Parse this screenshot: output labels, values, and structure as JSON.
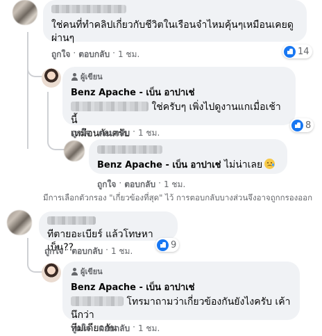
{
  "comments": [
    {
      "text": "ใช่คนที่ทำคลิปเกี่ยวกับชีวิตในเรือนจำไหมคุ้นๆเหมือนเคยดูผ่านๆ",
      "line1": "ใช่คนที่ทำคลิปเกี่ยวกับชีวิตในเรือนจำไหมคุ้นๆเหมือนเคยดู",
      "line2": "ผ่านๆ",
      "like": "ถูกใจ",
      "reply": "ตอบกลับ",
      "time": "1 ชม.",
      "reactions": "14",
      "replies": [
        {
          "author_badge": "ผู้เขียน",
          "author": "Benz Apache - เบ็น อาปาเช่",
          "line1": "ใช่ครับๆ เพิ่งไปดูงานแกเมื่อเช้านี้",
          "line2": "เหมือนกันครับ",
          "like": "ถูกใจ",
          "reply": "ตอบกลับ",
          "time": "1 ชม.",
          "reactions": "8"
        },
        {
          "mention": "Benz Apache - เบ็น อาปาเช่",
          "text": "ไม่น่าเลย",
          "emoji": "sad-crying-emoji",
          "like": "ถูกใจ",
          "reply": "ตอบกลับ",
          "time": "1 ชม."
        }
      ]
    },
    {
      "text": "ทีตายอะเบียร์ แล้วโทษหาเบ็น??",
      "like": "ถูกใจ",
      "reply": "ตอบกลับ",
      "time": "1 ชม.",
      "reactions": "9",
      "replies": [
        {
          "author_badge": "ผู้เขียน",
          "author": "Benz Apache - เบ็น อาปาเช่",
          "line1": "โทรมาถามว่าเกี่ยวข้องกันยังไงครับ เค้านึกว่า",
          "line2": "ทีมเดียวกัน",
          "like": "ถูกใจ",
          "reply": "ตอบกลับ",
          "time": "1 ชม."
        }
      ]
    }
  ],
  "filter_notice": "มีการเลือกตัวกรอง \"เกี่ยวข้องที่สุด\" ไว้ การตอบกลับบางส่วนจึงอาจถูกกรองออก",
  "colors": {
    "like_blue": "#1877f2",
    "bubble": "#f0f2f5",
    "meta_gray": "#65676b"
  }
}
